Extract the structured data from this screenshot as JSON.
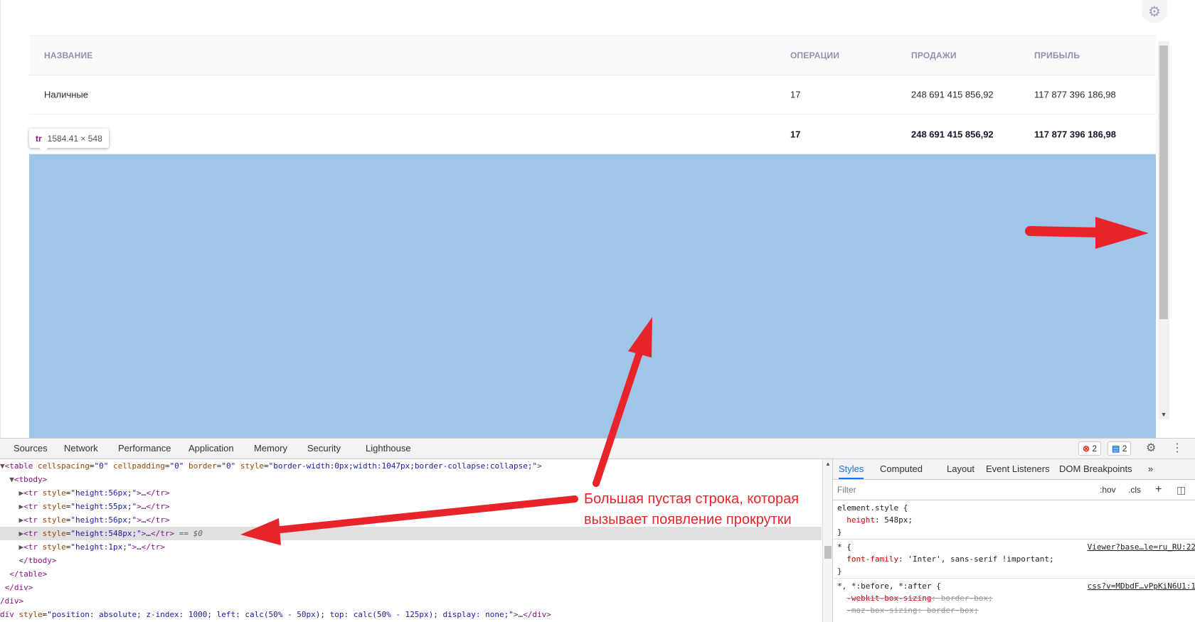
{
  "page": {
    "settings_icon": "gear-icon",
    "table": {
      "headers": [
        "НАЗВАНИЕ",
        "ОПЕРАЦИИ",
        "ПРОДАЖИ",
        "ПРИБЫЛЬ"
      ],
      "rows": [
        {
          "name": "Наличные",
          "operations": "17",
          "sales": "248 691 415 856,92",
          "profit": "117 877 396 186,98"
        }
      ],
      "total": {
        "name": "",
        "operations": "17",
        "sales": "248 691 415 856,92",
        "profit": "117 877 396 186,98"
      }
    },
    "inspect_tooltip": {
      "tag": "tr",
      "size": "1584.41 × 548"
    },
    "highlight_color": "#9fc5e8"
  },
  "devtools": {
    "tabs": [
      "Sources",
      "Network",
      "Performance",
      "Application",
      "Memory",
      "Security",
      "Lighthouse"
    ],
    "errors_count": "2",
    "messages_count": "2",
    "elements": {
      "table_open": {
        "tag": "table",
        "cellspacing": "0",
        "cellpadding": "0",
        "border": "0",
        "style": "border-width:0px;width:1047px;border-collapse:collapse;"
      },
      "tbody": "tbody",
      "rows": [
        {
          "style": "height:56px;"
        },
        {
          "style": "height:55px;"
        },
        {
          "style": "height:56px;"
        },
        {
          "style": "height:548px;",
          "selected": true,
          "marker": "== $0"
        },
        {
          "style": "height:1px;"
        }
      ],
      "closing_lines": [
        "</tbody>",
        "</table>",
        "</div>",
        "/div>"
      ],
      "last_line": {
        "style": "position: absolute; z-index: 1000; left: calc(50% - 50px); top: calc(50% - 125px); display: none;"
      }
    },
    "styles_panel": {
      "tabs": [
        "Styles",
        "Computed",
        "Layout",
        "Event Listeners",
        "DOM Breakpoints"
      ],
      "more": "»",
      "filter_placeholder": "Filter",
      "hov": ":hov",
      "cls": ".cls",
      "plus": "+",
      "rules": [
        {
          "selector": "element.style {",
          "props": [
            {
              "name": "height",
              "value": "548px;"
            }
          ],
          "source": ""
        },
        {
          "selector": "* {",
          "props": [
            {
              "name": "font-family",
              "value": "'Inter', sans-serif !important;"
            }
          ],
          "source": "Viewer?base…le=ru_RU:22"
        },
        {
          "selector": "*, *:before, *:after {",
          "props": [
            {
              "name": "-webkit-box-sizing",
              "value": "border-box;"
            },
            {
              "name": "-moz-box-sizing",
              "value": "border-box;"
            }
          ],
          "source": "css?v=MDbdF…vPpKiN6U1:1"
        }
      ]
    }
  },
  "annotation": {
    "text_line1": "Большая пустая строка, которая",
    "text_line2": "вызывает появление прокрутки",
    "color": "#e8242a"
  }
}
